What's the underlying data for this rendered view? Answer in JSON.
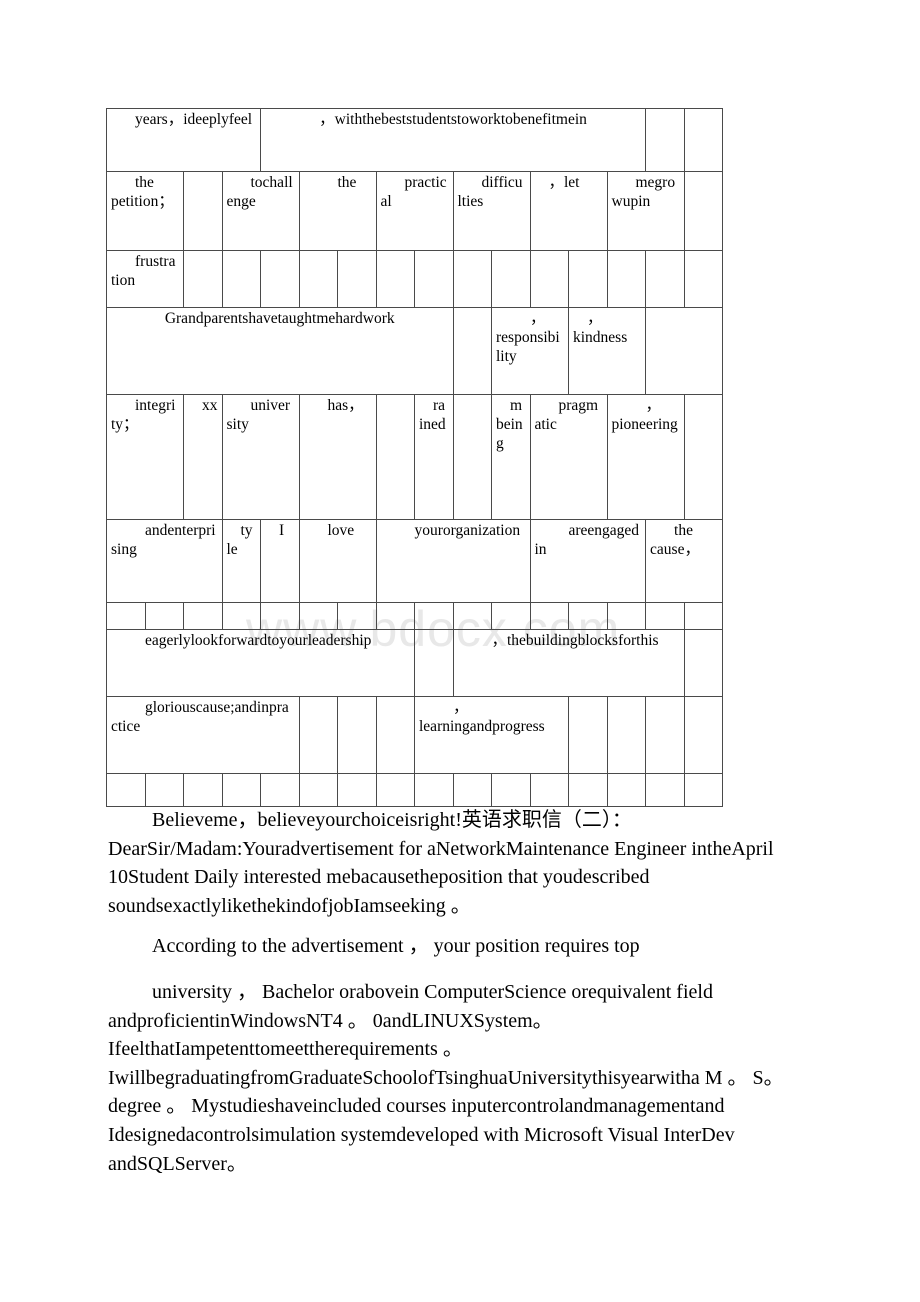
{
  "page": {
    "watermark": "www.bdocx.com"
  },
  "table": {
    "rows": [
      {
        "name": "row-1",
        "cells": [
          {
            "text": "years，ideeplyfeel",
            "span": 4,
            "align": "indent"
          },
          {
            "text": "，withthebeststudentstoworktobenefitmein",
            "span": 10,
            "align": "center"
          },
          {
            "text": "",
            "span": 1,
            "align": "indent"
          },
          {
            "text": "",
            "span": 1,
            "align": "indent"
          }
        ]
      },
      {
        "name": "row-2",
        "cells": [
          {
            "text": "the petition；",
            "span": 2,
            "align": "indent"
          },
          {
            "text": "",
            "span": 1,
            "align": "indent"
          },
          {
            "text": "tochallenge",
            "span": 2,
            "align": "indent"
          },
          {
            "text": "the",
            "span": 2,
            "align": "indent2"
          },
          {
            "text": "practical",
            "span": 2,
            "align": "indent"
          },
          {
            "text": "difficulties",
            "span": 2,
            "align": "indent"
          },
          {
            "text": "，let",
            "span": 2,
            "align": "indent-sm"
          },
          {
            "text": "megrowupin",
            "span": 2,
            "align": "indent"
          },
          {
            "text": "",
            "span": 1,
            "align": "indent"
          }
        ]
      },
      {
        "name": "row-3",
        "cells": [
          {
            "text": "frustration",
            "span": 2,
            "align": "indent"
          },
          {
            "text": "",
            "span": 1,
            "align": "indent"
          },
          {
            "text": "",
            "span": 1,
            "align": "indent"
          },
          {
            "text": "",
            "span": 1,
            "align": "indent"
          },
          {
            "text": "",
            "span": 1,
            "align": "indent"
          },
          {
            "text": "",
            "span": 1,
            "align": "indent"
          },
          {
            "text": "",
            "span": 1,
            "align": "indent"
          },
          {
            "text": "",
            "span": 1,
            "align": "indent"
          },
          {
            "text": "",
            "span": 1,
            "align": "indent"
          },
          {
            "text": "",
            "span": 1,
            "align": "indent"
          },
          {
            "text": "",
            "span": 1,
            "align": "indent"
          },
          {
            "text": "",
            "span": 1,
            "align": "indent"
          },
          {
            "text": "",
            "span": 1,
            "align": "indent"
          },
          {
            "text": "",
            "span": 1,
            "align": "indent"
          },
          {
            "text": "",
            "span": 1,
            "align": "indent"
          }
        ]
      },
      {
        "name": "row-4",
        "cells": [
          {
            "text": "Grandparentshavetaughtmehardwork",
            "span": 9,
            "align": "center"
          },
          {
            "text": "",
            "span": 1,
            "align": "indent"
          },
          {
            "text": "，responsibility",
            "span": 2,
            "align": "indent2"
          },
          {
            "text": "，kindness",
            "span": 2,
            "align": "indent-sm"
          },
          {
            "text": "",
            "span": 2,
            "align": "indent"
          }
        ]
      },
      {
        "name": "row-5",
        "cells": [
          {
            "text": "integrity；",
            "span": 2,
            "align": "indent"
          },
          {
            "text": "xx",
            "span": 1,
            "align": "indent-sm"
          },
          {
            "text": "university",
            "span": 2,
            "align": "indent"
          },
          {
            "text": "has，",
            "span": 2,
            "align": "indent"
          },
          {
            "text": "",
            "span": 1,
            "align": "indent"
          },
          {
            "text": "rained",
            "span": 1,
            "align": "indent-sm"
          },
          {
            "text": "",
            "span": 1,
            "align": "indent"
          },
          {
            "text": "mbeing",
            "span": 1,
            "align": "indent-sm"
          },
          {
            "text": "pragmatic",
            "span": 2,
            "align": "indent"
          },
          {
            "text": "，pioneering",
            "span": 2,
            "align": "indent2"
          },
          {
            "text": "",
            "span": 1,
            "align": "indent"
          }
        ]
      },
      {
        "name": "row-6",
        "cells": [
          {
            "text": "andenterprising",
            "span": 3,
            "align": "indent2"
          },
          {
            "text": "tyle",
            "span": 1,
            "align": "indent-sm"
          },
          {
            "text": "I",
            "span": 1,
            "align": "indent-sm"
          },
          {
            "text": "love",
            "span": 2,
            "align": "indent"
          },
          {
            "text": "yourorganization",
            "span": 4,
            "align": "indent2"
          },
          {
            "text": "areengagedin",
            "span": 3,
            "align": "indent2"
          },
          {
            "text": "the cause，",
            "span": 2,
            "align": "indent"
          }
        ]
      },
      {
        "name": "row-7-spacer",
        "cells": [
          {
            "text": "",
            "span": 1,
            "align": "indent"
          },
          {
            "text": "",
            "span": 1,
            "align": "indent"
          },
          {
            "text": "",
            "span": 1,
            "align": "indent"
          },
          {
            "text": "",
            "span": 1,
            "align": "indent"
          },
          {
            "text": "",
            "span": 1,
            "align": "indent"
          },
          {
            "text": "",
            "span": 1,
            "align": "indent"
          },
          {
            "text": "",
            "span": 1,
            "align": "indent"
          },
          {
            "text": "",
            "span": 1,
            "align": "indent"
          },
          {
            "text": "",
            "span": 1,
            "align": "indent"
          },
          {
            "text": "",
            "span": 1,
            "align": "indent"
          },
          {
            "text": "",
            "span": 1,
            "align": "indent"
          },
          {
            "text": "",
            "span": 1,
            "align": "indent"
          },
          {
            "text": "",
            "span": 1,
            "align": "indent"
          },
          {
            "text": "",
            "span": 1,
            "align": "indent"
          },
          {
            "text": "",
            "span": 1,
            "align": "indent"
          },
          {
            "text": "",
            "span": 1,
            "align": "indent"
          }
        ]
      },
      {
        "name": "row-8",
        "cells": [
          {
            "text": "eagerlylookforwardtoyourleadership",
            "span": 8,
            "align": "indent2"
          },
          {
            "text": "",
            "span": 1,
            "align": "indent"
          },
          {
            "text": "，thebuildingblocksforthis",
            "span": 6,
            "align": "indent2"
          },
          {
            "text": "",
            "span": 1,
            "align": "indent"
          }
        ]
      },
      {
        "name": "row-9",
        "cells": [
          {
            "text": "gloriouscause;andinpractice",
            "span": 5,
            "align": "indent2"
          },
          {
            "text": "",
            "span": 1,
            "align": "indent"
          },
          {
            "text": "",
            "span": 1,
            "align": "indent"
          },
          {
            "text": "",
            "span": 1,
            "align": "indent"
          },
          {
            "text": "，learningandprogress",
            "span": 4,
            "align": "indent2"
          },
          {
            "text": "",
            "span": 1,
            "align": "indent"
          },
          {
            "text": "",
            "span": 1,
            "align": "indent"
          },
          {
            "text": "",
            "span": 1,
            "align": "indent"
          },
          {
            "text": "",
            "span": 1,
            "align": "indent"
          }
        ]
      },
      {
        "name": "row-10-spacer",
        "cells": [
          {
            "text": "",
            "span": 1,
            "align": "indent"
          },
          {
            "text": "",
            "span": 1,
            "align": "indent"
          },
          {
            "text": "",
            "span": 1,
            "align": "indent"
          },
          {
            "text": "",
            "span": 1,
            "align": "indent"
          },
          {
            "text": "",
            "span": 1,
            "align": "indent"
          },
          {
            "text": "",
            "span": 1,
            "align": "indent"
          },
          {
            "text": "",
            "span": 1,
            "align": "indent"
          },
          {
            "text": "",
            "span": 1,
            "align": "indent"
          },
          {
            "text": "",
            "span": 1,
            "align": "indent"
          },
          {
            "text": "",
            "span": 1,
            "align": "indent"
          },
          {
            "text": "",
            "span": 1,
            "align": "indent"
          },
          {
            "text": "",
            "span": 1,
            "align": "indent"
          },
          {
            "text": "",
            "span": 1,
            "align": "indent"
          },
          {
            "text": "",
            "span": 1,
            "align": "indent"
          },
          {
            "text": "",
            "span": 1,
            "align": "indent"
          },
          {
            "text": "",
            "span": 1,
            "align": "indent"
          }
        ]
      }
    ]
  },
  "body": {
    "paragraph_1": "Believeme，believeyourchoiceisright!英语求职信（二）：DearSir/Madam:Youradvertisement for aNetworkMaintenance Engineer intheApril 10Student Daily interested mebacausetheposition that youdescribed soundsexactlylikethekindofjobIamseeking 。",
    "paragraph_2": "According to the advertisement ， your position requires top",
    "paragraph_3": "university ， Bachelor orabovein ComputerScience orequivalent field andproficientinWindowsNT4 。 0andLINUXSystem。IfeelthatIampetenttomeettherequirements 。IwillbegraduatingfromGraduateSchoolofTsinghuaUniversitythisyearwitha M 。 S。 degree 。 Mystudieshaveincluded courses inputercontrolandmanagementand Idesignedacontrolsimulation systemdeveloped with Microsoft Visual InterDev andSQLServer。"
  }
}
